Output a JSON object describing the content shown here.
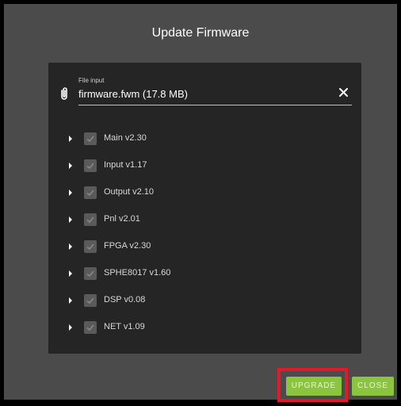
{
  "dialog": {
    "title": "Update Firmware"
  },
  "file_input": {
    "label": "File input",
    "value": "firmware.fwm (17.8 MB)",
    "icon": "paperclip-icon",
    "clear_icon": "close-icon"
  },
  "firmware_items": [
    {
      "label": "Main v2.30",
      "checked": true
    },
    {
      "label": "Input v1.17",
      "checked": true
    },
    {
      "label": "Output v2.10",
      "checked": true
    },
    {
      "label": "Pnl v2.01",
      "checked": true
    },
    {
      "label": "FPGA v2.30",
      "checked": true
    },
    {
      "label": "SPHE8017 v1.60",
      "checked": true
    },
    {
      "label": "DSP v0.08",
      "checked": true
    },
    {
      "label": "NET v1.09",
      "checked": true
    }
  ],
  "buttons": {
    "upgrade": "UPGRADE",
    "close": "CLOSE"
  },
  "colors": {
    "accent": "#8bc43f",
    "highlight": "#e0192b",
    "panel": "#252525",
    "dialog": "#4b4b4b"
  }
}
